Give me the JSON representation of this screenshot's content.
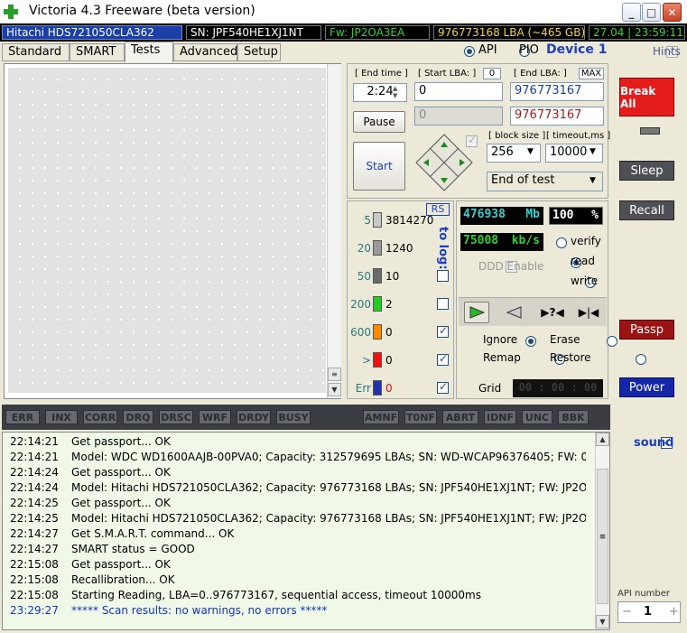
{
  "window": {
    "title": "Victoria 4.3 Freeware (beta version)",
    "minimize": "_",
    "maximize": "□",
    "close": "✕"
  },
  "info": {
    "model": "Hitachi HDS721050CLA362",
    "serial": "SN: JPF540HE1XJ1NT",
    "firmware": "Fw: JP2OA3EA",
    "lba": "976773168 LBA (~465 GB)",
    "datetime": "27.04 | 23:59:11"
  },
  "tabs": [
    {
      "label": "Standard"
    },
    {
      "label": "SMART"
    },
    {
      "label": "Tests"
    },
    {
      "label": "Advanced"
    },
    {
      "label": "Setup"
    }
  ],
  "mode": {
    "api": "API",
    "pio": "PIO",
    "device": "Device 1",
    "hints": "Hints"
  },
  "test": {
    "end_time_label": "[ End time ]",
    "end_time": "2:24",
    "start_lba_label": "[ Start LBA: ]",
    "start_lba_zero": "0",
    "start_lba": "0",
    "start_lba2": "0",
    "end_lba_label": "[ End LBA: ]",
    "end_lba_max": "MAX",
    "end_lba": "976773167",
    "end_lba2": "976773167",
    "pause": "Pause",
    "start": "Start",
    "block_size_label": "[ block size ]",
    "block_size": "256",
    "timeout_label": "[ timeout,ms ]",
    "timeout": "10000",
    "end_action": "End of test"
  },
  "sensors": {
    "rs": "RS",
    "to_log": "to log:",
    "rows": [
      {
        "label": "5",
        "count": "3814270",
        "color": "#c8c8c8"
      },
      {
        "label": "20",
        "count": "1240",
        "color": "#9a9a9a"
      },
      {
        "label": "50",
        "count": "10",
        "color": "#6a6a6a"
      },
      {
        "label": "200",
        "count": "2",
        "color": "#22cc22"
      },
      {
        "label": "600",
        "count": "0",
        "color": "#ff8800"
      },
      {
        "label": ">",
        "count": "0",
        "color": "#ee1111"
      },
      {
        "label": "Err",
        "count": "0",
        "color": "#2233aa"
      }
    ]
  },
  "stats": {
    "mb": "476938",
    "mb_unit": "Mb",
    "percent": "100",
    "percent_unit": "%",
    "speed": "75008",
    "speed_unit": "kb/s",
    "verify": "verify",
    "read": "read",
    "write": "write",
    "ddd": "DDD Enable",
    "ignore": "Ignore",
    "erase": "Erase",
    "remap": "Remap",
    "restore": "Restore",
    "grid": "Grid",
    "grid_timer": "00 : 00 : 00"
  },
  "side": {
    "break_all": "Break All",
    "sleep": "Sleep",
    "recall": "Recall",
    "passp": "Passp",
    "power": "Power",
    "sound": "sound",
    "api_number_label": "API number",
    "api_number": "1",
    "minus": "−",
    "plus": "+"
  },
  "error_flags": [
    "ERR",
    "INX",
    "CORR",
    "DRQ",
    "DRSC",
    "WRF",
    "DRDY",
    "BUSY",
    "AMNF",
    "T0NF",
    "ABRT",
    "IDNF",
    "UNC",
    "BBK"
  ],
  "log": [
    {
      "time": "22:14:21",
      "msg": "Get passport... OK",
      "color": "#000000"
    },
    {
      "time": "22:14:21",
      "msg": "Model: WDC WD1600AAJB-00PVA0; Capacity: 312579695 LBAs; SN: WD-WCAP96376405; FW: 0...",
      "color": "#000000"
    },
    {
      "time": "22:14:24",
      "msg": "Get passport... OK",
      "color": "#000000"
    },
    {
      "time": "22:14:24",
      "msg": "Model: Hitachi HDS721050CLA362; Capacity: 976773168 LBAs; SN: JPF540HE1XJ1NT; FW: JP2O...",
      "color": "#000000"
    },
    {
      "time": "22:14:25",
      "msg": "Get passport... OK",
      "color": "#000000"
    },
    {
      "time": "22:14:25",
      "msg": "Model: Hitachi HDS721050CLA362; Capacity: 976773168 LBAs; SN: JPF540HE1XJ1NT; FW: JP2O...",
      "color": "#000000"
    },
    {
      "time": "22:14:27",
      "msg": "Get S.M.A.R.T. command... OK",
      "color": "#000000"
    },
    {
      "time": "22:14:27",
      "msg": "SMART status = GOOD",
      "color": "#000000"
    },
    {
      "time": "22:15:08",
      "msg": "Get passport... OK",
      "color": "#000000"
    },
    {
      "time": "22:15:08",
      "msg": "Recallibration... OK",
      "color": "#000000"
    },
    {
      "time": "22:15:08",
      "msg": "Starting Reading, LBA=0..976773167, sequential access, timeout 10000ms",
      "color": "#000000"
    },
    {
      "time": "23:29:27",
      "msg": "***** Scan results: no warnings, no errors *****",
      "color": "#1133cc"
    }
  ]
}
